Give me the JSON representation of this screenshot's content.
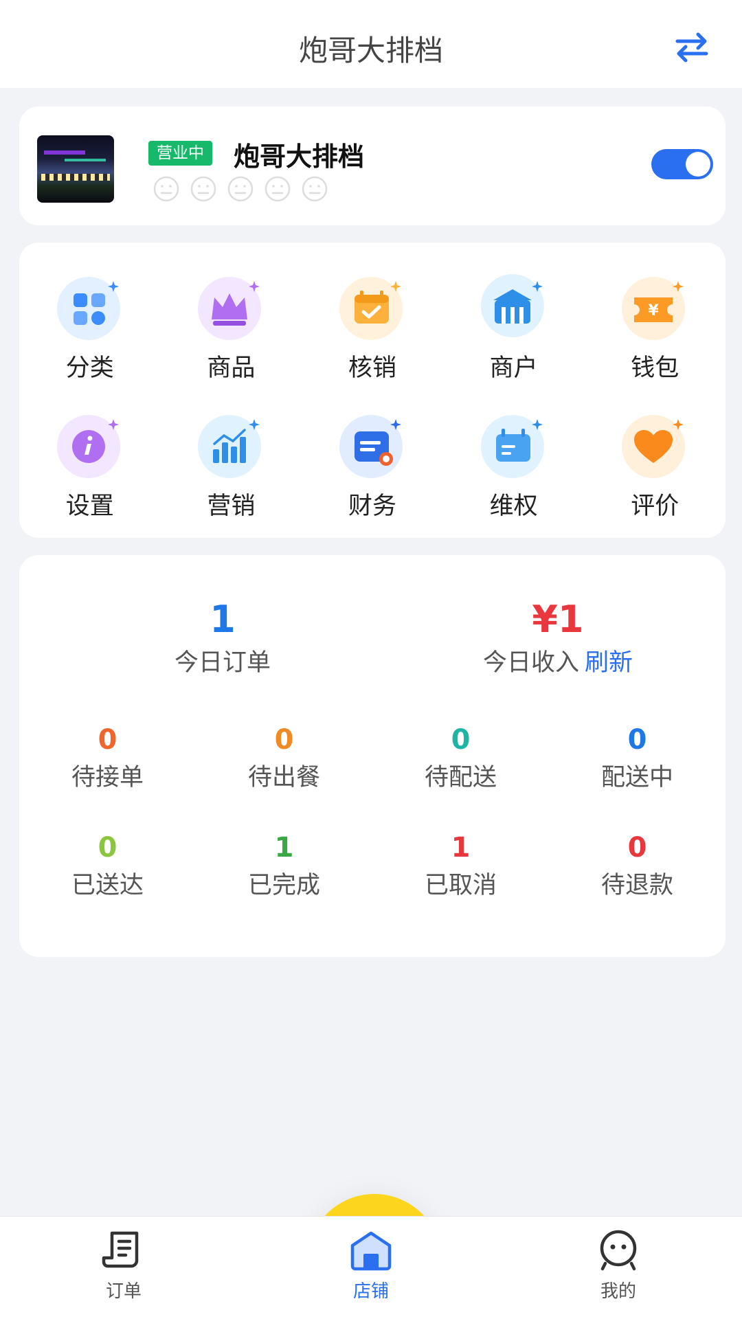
{
  "header": {
    "title": "炮哥大排档",
    "switch_icon": "swap-arrows-icon",
    "accent": "#2a6ff0"
  },
  "shop": {
    "status": "营业中",
    "name": "炮哥大排档",
    "status_color": "#16b86a",
    "rating_faces": 5,
    "toggle_on": true
  },
  "menu": {
    "items": [
      {
        "label": "分类",
        "icon": "category-grid-icon"
      },
      {
        "label": "商品",
        "icon": "crown-icon"
      },
      {
        "label": "核销",
        "icon": "calendar-check-icon"
      },
      {
        "label": "商户",
        "icon": "storefront-icon"
      },
      {
        "label": "钱包",
        "icon": "wallet-yuan-icon"
      },
      {
        "label": "设置",
        "icon": "info-settings-icon"
      },
      {
        "label": "营销",
        "icon": "bar-chart-icon"
      },
      {
        "label": "财务",
        "icon": "finance-doc-icon"
      },
      {
        "label": "维权",
        "icon": "rights-calendar-icon"
      },
      {
        "label": "评价",
        "icon": "heart-icon"
      }
    ]
  },
  "stats": {
    "today_orders": {
      "value": "1",
      "label": "今日订单",
      "color": "#1e78e8"
    },
    "today_income": {
      "value": "¥1",
      "label": "今日收入",
      "refresh": "刷新",
      "color": "#e8383d"
    },
    "items": [
      {
        "value": "0",
        "label": "待接单",
        "color": "#f0652a"
      },
      {
        "value": "0",
        "label": "待出餐",
        "color": "#f08a24"
      },
      {
        "value": "0",
        "label": "待配送",
        "color": "#1fb5a5"
      },
      {
        "value": "0",
        "label": "配送中",
        "color": "#1e78e8"
      },
      {
        "value": "0",
        "label": "已送达",
        "color": "#8cc63f"
      },
      {
        "value": "1",
        "label": "已完成",
        "color": "#3aa845"
      },
      {
        "value": "1",
        "label": "已取消",
        "color": "#e8383d"
      },
      {
        "value": "0",
        "label": "待退款",
        "color": "#e8383d"
      }
    ]
  },
  "tabbar": {
    "tabs": [
      {
        "label": "订单",
        "icon": "order-receipt-icon"
      },
      {
        "label": "店铺",
        "icon": "store-home-icon",
        "active": true
      },
      {
        "label": "我的",
        "icon": "user-face-icon"
      }
    ]
  }
}
